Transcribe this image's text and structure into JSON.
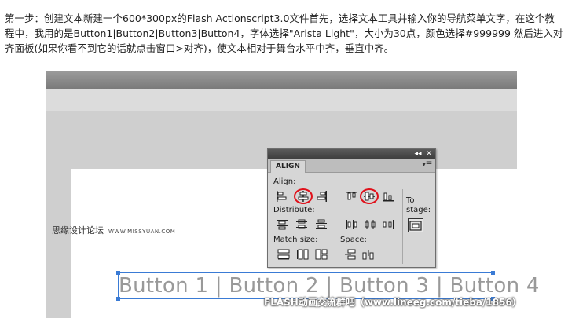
{
  "article": {
    "instructions": "第一步：创建文本新建一个600*300px的Flash Actionscript3.0文件首先，选择文本工具并输入你的导航菜单文字，在这个教程中，我用的是Button1|Button2|Button3|Button4，字体选择\"Arista Light\"，大小为30点，颜色选择#999999 然后进入对齐面板(如果你看不到它的话就点击窗口>对齐)，使文本相对于舞台水平中齐，垂直中齐。"
  },
  "watermarks": {
    "left_cn": "思缘设计论坛",
    "left_url": "WWW.MISSYUAN.COM",
    "right": "FLASH动画交流群吧（www.lineeg.com/tieba/1856）"
  },
  "align_panel": {
    "tab_label": "ALIGN",
    "menu_icon": "panel-menu-icon",
    "collapse_label": "◂◂",
    "close_label": "✕",
    "align_label": "Align:",
    "distribute_label": "Distribute:",
    "match_size_label": "Match size:",
    "space_label": "Space:",
    "to_stage_label_1": "To",
    "to_stage_label_2": "stage:",
    "highlighted_buttons": [
      "align-horizontal-center",
      "align-vertical-center"
    ]
  },
  "stage": {
    "text_content": "Button 1 | Button 2 | Button 3 | Button 4",
    "text_color": "#999999"
  },
  "colors": {
    "highlight": "#e0101a",
    "selection": "#3a7bd5"
  }
}
